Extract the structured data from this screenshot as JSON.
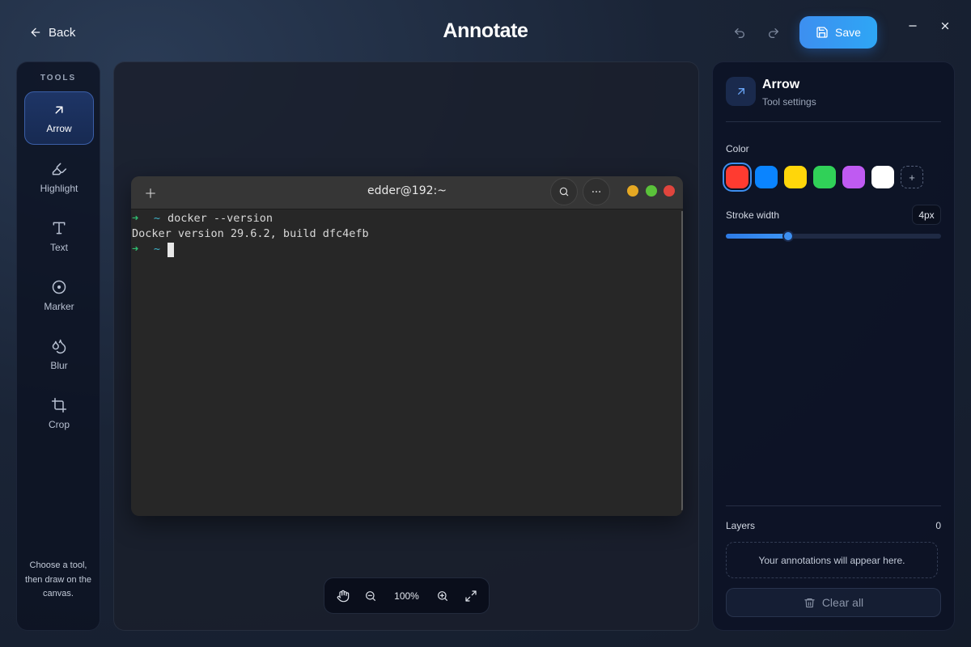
{
  "header": {
    "back_label": "Back",
    "title": "Annotate",
    "save_label": "Save",
    "undo_icon": "undo-icon",
    "redo_icon": "redo-icon"
  },
  "tools": {
    "heading": "TOOLS",
    "items": [
      {
        "label": "Arrow",
        "icon": "arrow-icon",
        "active": true
      },
      {
        "label": "Highlight",
        "icon": "highlighter-icon",
        "active": false
      },
      {
        "label": "Text",
        "icon": "text-icon",
        "active": false
      },
      {
        "label": "Marker",
        "icon": "marker-icon",
        "active": false
      },
      {
        "label": "Blur",
        "icon": "blur-icon",
        "active": false
      },
      {
        "label": "Crop",
        "icon": "crop-icon",
        "active": false
      }
    ],
    "hint": "Choose a tool, then draw on the canvas."
  },
  "terminal": {
    "title": "edder@192:~",
    "lines": [
      {
        "prompt": true,
        "text": "docker --version"
      },
      {
        "prompt": false,
        "text": "Docker version 29.6.2, build dfc4efb"
      },
      {
        "prompt": true,
        "text": "",
        "cursor": true
      }
    ],
    "prompt_arrow": "➜",
    "prompt_dir": "~"
  },
  "zoom": {
    "level": "100%"
  },
  "settings": {
    "title": "Arrow",
    "subtitle": "Tool settings",
    "color_label": "Color",
    "colors": [
      "#ff3b30",
      "#0a84ff",
      "#ffd60a",
      "#30d158",
      "#bf5af2",
      "#ffffff"
    ],
    "selected_color": "#ff3b30",
    "add_color_label": "+",
    "stroke_label": "Stroke width",
    "stroke_value": "4px",
    "stroke_fraction": 0.29,
    "layers_label": "Layers",
    "layers_count": "0",
    "empty_text": "Your annotations will appear here.",
    "clear_label": "Clear all"
  },
  "colors": {
    "accent": "#3d8ff0",
    "traffic_yellow": "#e5a823",
    "traffic_green": "#5ac23a",
    "traffic_red": "#e0453d"
  }
}
